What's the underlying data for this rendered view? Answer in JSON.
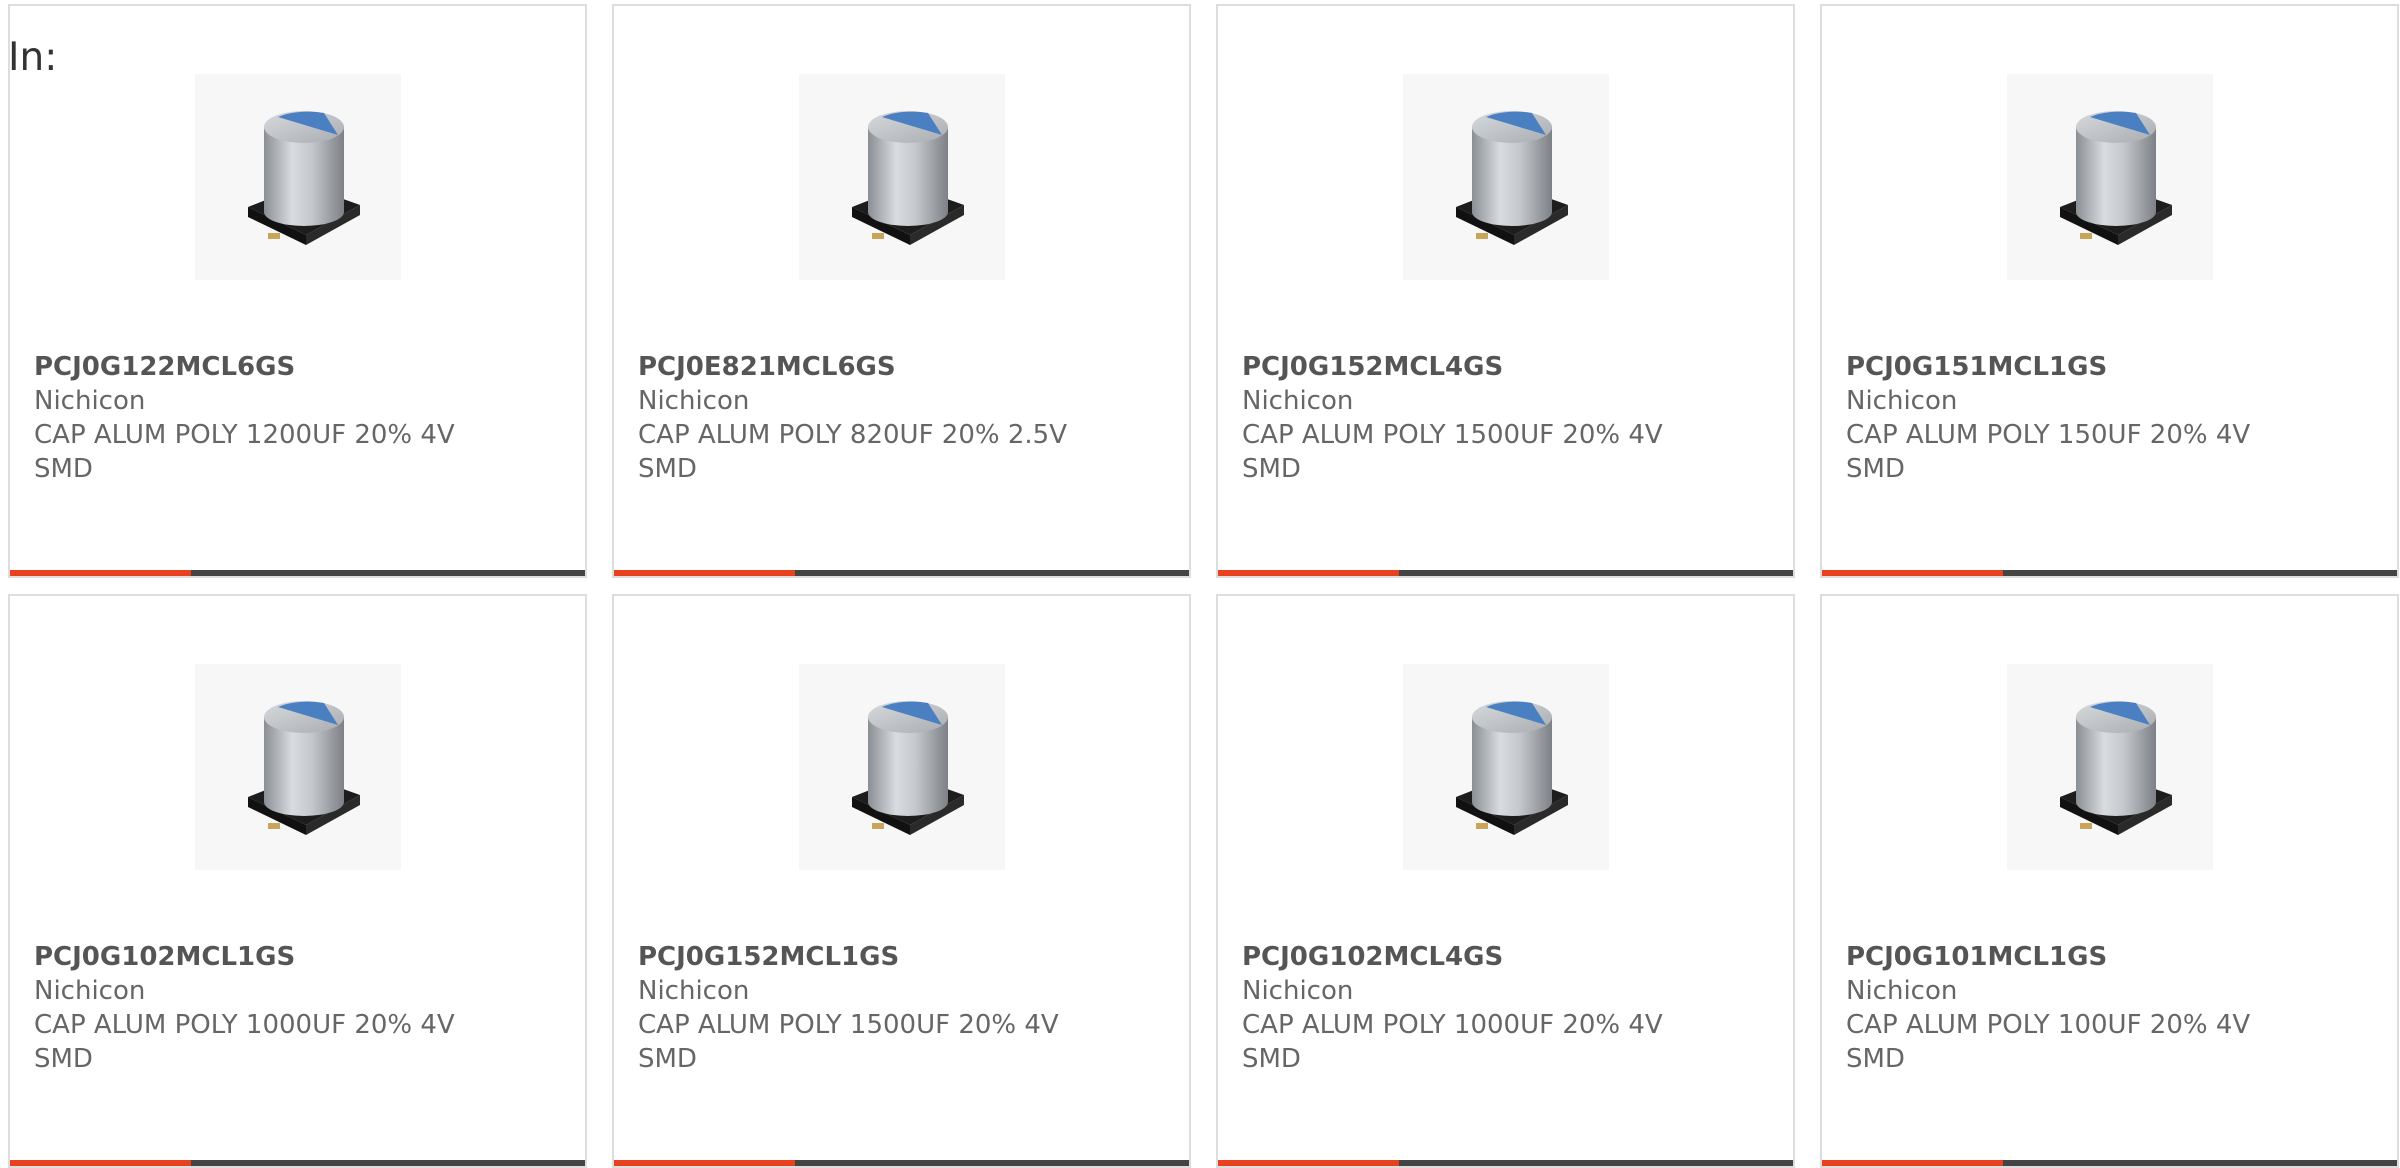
{
  "header": {
    "in_label": "In:"
  },
  "colors": {
    "accent": "#e8411d",
    "bar_dark": "#444444",
    "border": "#dddddd",
    "text": "#666666"
  },
  "products": [
    {
      "part": "PCJ0G122MCL6GS",
      "manufacturer": "Nichicon",
      "desc_line1": "CAP ALUM POLY 1200UF 20% 4V",
      "desc_line2": "SMD",
      "image_icon": "capacitor-smd-image"
    },
    {
      "part": "PCJ0E821MCL6GS",
      "manufacturer": "Nichicon",
      "desc_line1": "CAP ALUM POLY 820UF 20% 2.5V",
      "desc_line2": "SMD",
      "image_icon": "capacitor-smd-image"
    },
    {
      "part": "PCJ0G152MCL4GS",
      "manufacturer": "Nichicon",
      "desc_line1": "CAP ALUM POLY 1500UF 20% 4V",
      "desc_line2": "SMD",
      "image_icon": "capacitor-smd-image"
    },
    {
      "part": "PCJ0G151MCL1GS",
      "manufacturer": "Nichicon",
      "desc_line1": "CAP ALUM POLY 150UF 20% 4V",
      "desc_line2": "SMD",
      "image_icon": "capacitor-smd-image"
    },
    {
      "part": "PCJ0G102MCL1GS",
      "manufacturer": "Nichicon",
      "desc_line1": "CAP ALUM POLY 1000UF 20% 4V",
      "desc_line2": "SMD",
      "image_icon": "capacitor-smd-image"
    },
    {
      "part": "PCJ0G152MCL1GS",
      "manufacturer": "Nichicon",
      "desc_line1": "CAP ALUM POLY 1500UF 20% 4V",
      "desc_line2": "SMD",
      "image_icon": "capacitor-smd-image"
    },
    {
      "part": "PCJ0G102MCL4GS",
      "manufacturer": "Nichicon",
      "desc_line1": "CAP ALUM POLY 1000UF 20% 4V",
      "desc_line2": "SMD",
      "image_icon": "capacitor-smd-image"
    },
    {
      "part": "PCJ0G101MCL1GS",
      "manufacturer": "Nichicon",
      "desc_line1": "CAP ALUM POLY 100UF 20% 4V",
      "desc_line2": "SMD",
      "image_icon": "capacitor-smd-image"
    }
  ]
}
